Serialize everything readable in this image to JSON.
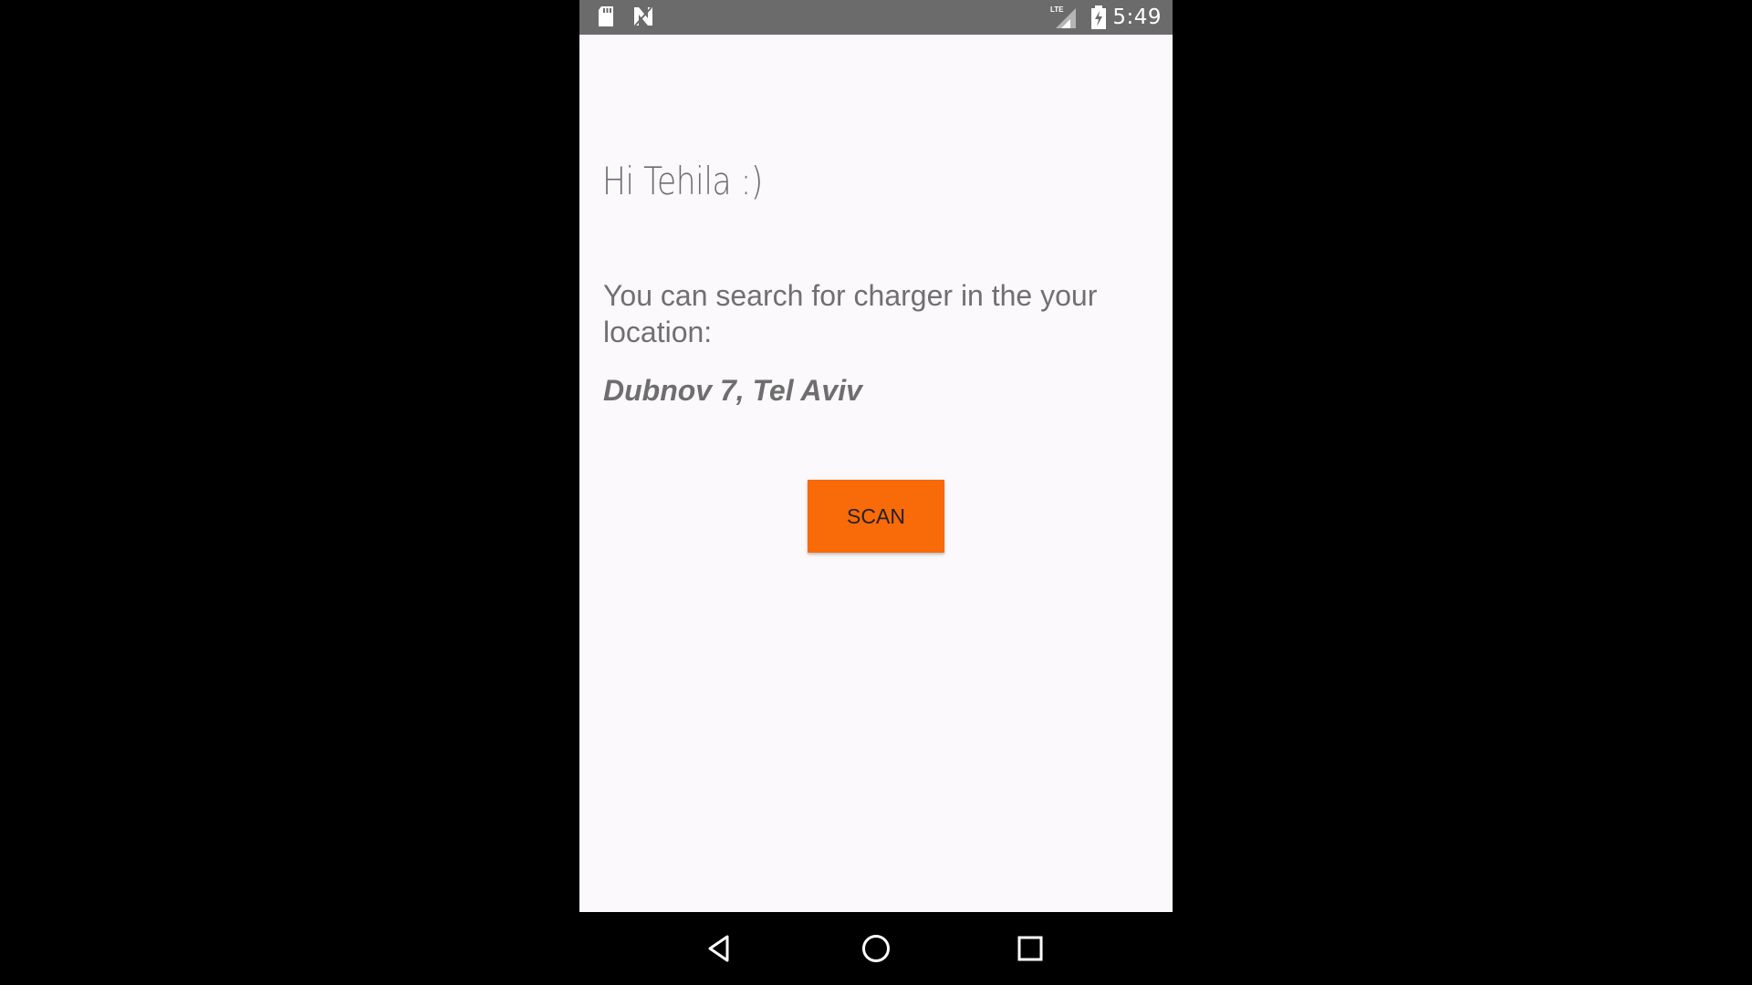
{
  "status_bar": {
    "time": "5:49",
    "icons": [
      "sd-card-icon",
      "n-notification-icon",
      "lte-signal-icon",
      "battery-charging-icon"
    ],
    "signal_label": "LTE"
  },
  "app": {
    "greeting": "Hi Tehila  :)",
    "info": "You can search for charger in the your location:",
    "location": "Dubnov 7, Tel Aviv",
    "scan_label": "SCAN"
  },
  "nav_bar": {
    "icons": [
      "back-icon",
      "home-icon",
      "recents-icon"
    ]
  },
  "colors": {
    "status_bar": "#6b6b6b",
    "background": "#fbf9fc",
    "accent": "#f96a08",
    "text": "#707070"
  }
}
